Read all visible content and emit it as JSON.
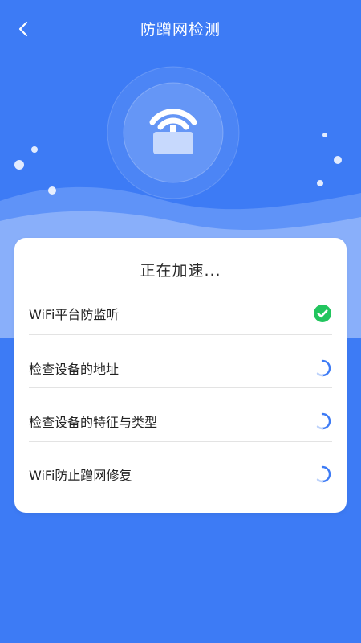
{
  "header": {
    "title": "防蹭网检测",
    "back_icon": "chevron-left-icon"
  },
  "hero": {
    "icon": "wifi-router-icon"
  },
  "card": {
    "title": "正在加速...",
    "items": [
      {
        "label": "WiFi平台防监听",
        "status": "done",
        "status_icon": "check-circle-icon"
      },
      {
        "label": "检查设备的地址",
        "status": "loading",
        "status_icon": "spinner-icon"
      },
      {
        "label": "检查设备的特征与类型",
        "status": "loading",
        "status_icon": "spinner-icon"
      },
      {
        "label": "WiFi防止蹭网修复",
        "status": "loading",
        "status_icon": "spinner-icon"
      }
    ]
  },
  "colors": {
    "background": "#3d7bf5",
    "check": "#22c55e",
    "spinner": "#3d7bf5"
  }
}
